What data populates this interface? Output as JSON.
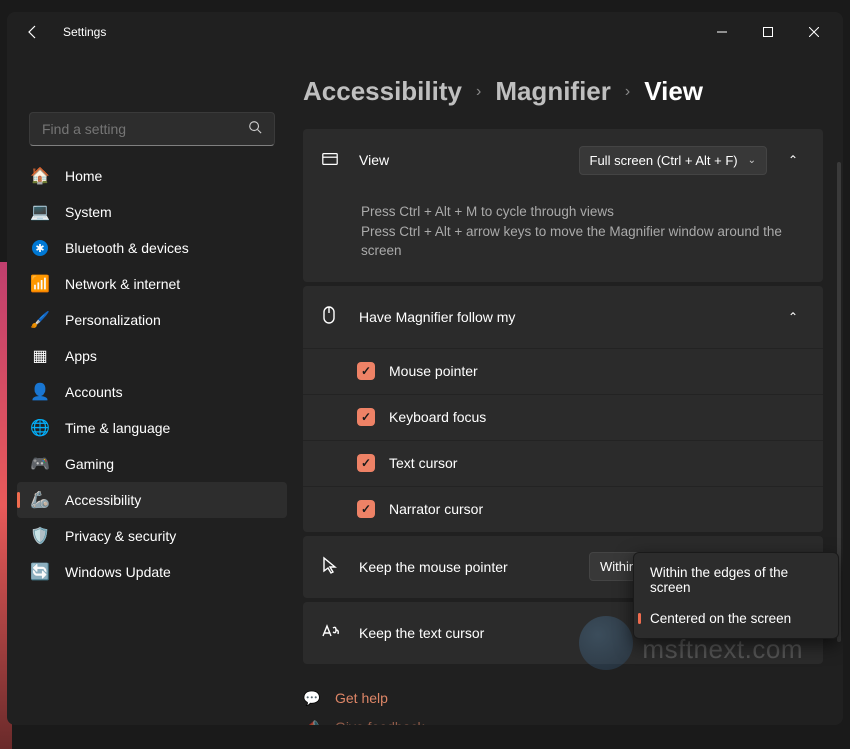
{
  "titlebar": {
    "title": "Settings"
  },
  "search": {
    "placeholder": "Find a setting"
  },
  "nav": [
    {
      "label": "Home"
    },
    {
      "label": "System"
    },
    {
      "label": "Bluetooth & devices"
    },
    {
      "label": "Network & internet"
    },
    {
      "label": "Personalization"
    },
    {
      "label": "Apps"
    },
    {
      "label": "Accounts"
    },
    {
      "label": "Time & language"
    },
    {
      "label": "Gaming"
    },
    {
      "label": "Accessibility"
    },
    {
      "label": "Privacy & security"
    },
    {
      "label": "Windows Update"
    }
  ],
  "breadcrumb": {
    "a": "Accessibility",
    "b": "Magnifier",
    "c": "View"
  },
  "view_card": {
    "label": "View",
    "value": "Full screen (Ctrl + Alt + F)",
    "help1": "Press Ctrl + Alt + M to cycle through views",
    "help2": "Press Ctrl + Alt + arrow keys to move the Magnifier window around the screen"
  },
  "follow_card": {
    "label": "Have Magnifier follow my",
    "opts": [
      {
        "label": "Mouse pointer"
      },
      {
        "label": "Keyboard focus"
      },
      {
        "label": "Text cursor"
      },
      {
        "label": "Narrator cursor"
      }
    ]
  },
  "mouse_card": {
    "label": "Keep the mouse pointer",
    "value": "Within the edges of the screen"
  },
  "text_card": {
    "label": "Keep the text cursor"
  },
  "flyout": {
    "opt1": "Within the edges of the screen",
    "opt2": "Centered on the screen"
  },
  "footer": {
    "help": "Get help",
    "feedback": "Give feedback"
  },
  "watermark": "msftnext.com"
}
